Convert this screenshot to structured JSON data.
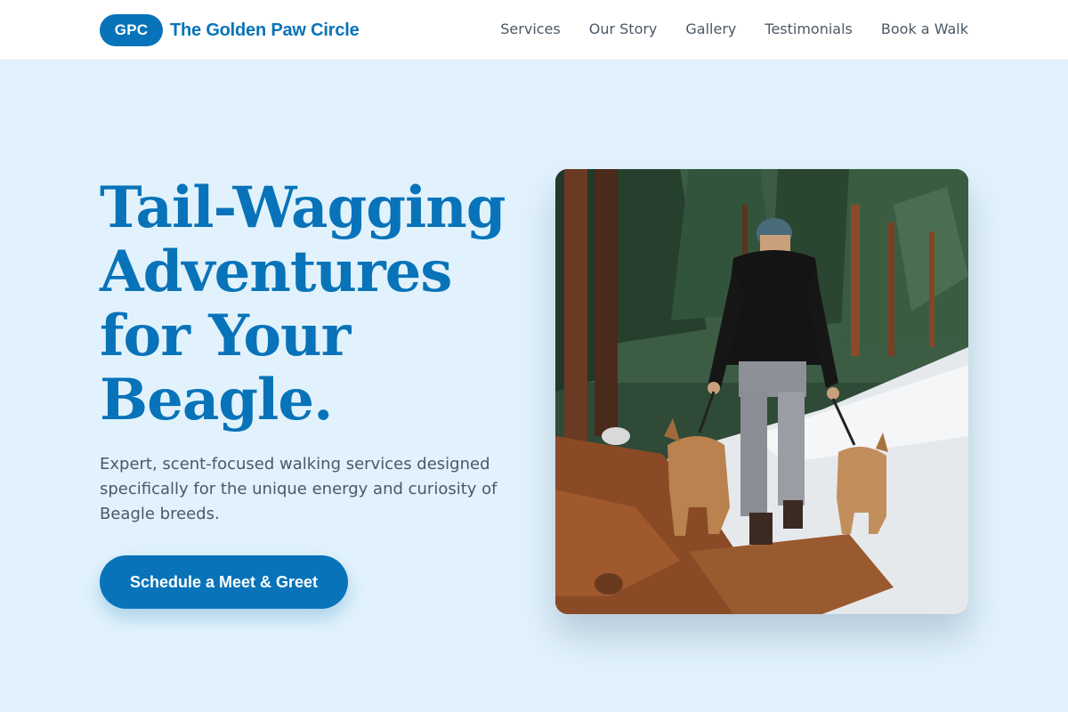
{
  "header": {
    "logo_badge": "GPC",
    "brand_name": "The Golden Paw Circle",
    "nav": [
      {
        "label": "Services"
      },
      {
        "label": "Our Story"
      },
      {
        "label": "Gallery"
      },
      {
        "label": "Testimonials"
      },
      {
        "label": "Book a Walk"
      }
    ]
  },
  "hero": {
    "title_lines": [
      "Tail-Wagging",
      "Adventures",
      "for Your",
      "Beagle."
    ],
    "subtitle": "Expert, scent-focused walking services designed specifically for the unique energy and curiosity of Beagle breeds.",
    "cta_label": "Schedule a Meet & Greet",
    "image_icon": "photo-person-walking-two-dogs-forest"
  },
  "colors": {
    "accent": "#0873b9",
    "page_background": "#e1f2fc",
    "header_background": "#ffffff",
    "body_text": "#4a5866"
  }
}
